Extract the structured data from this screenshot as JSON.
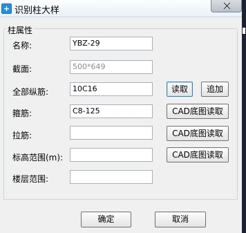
{
  "window": {
    "title": "识别柱大样",
    "close_glyph": "✕"
  },
  "group": {
    "title": "柱属性"
  },
  "fields": {
    "name": {
      "label": "名称:",
      "value": "YBZ-29"
    },
    "section": {
      "label": "截面:",
      "value": "500*649"
    },
    "all_longitudinal": {
      "label": "全部纵筋:",
      "value": "10C16"
    },
    "stirrup": {
      "label": "箍筋:",
      "value": "C8-125"
    },
    "tie": {
      "label": "拉筋:",
      "value": ""
    },
    "elevation_range": {
      "label": "标高范围(m):",
      "value": ""
    },
    "floor_range": {
      "label": "楼层范围:",
      "value": ""
    }
  },
  "buttons": {
    "read": "读取",
    "append": "追加",
    "cad_read_stirrup": "CAD底图读取",
    "cad_read_tie": "CAD底图读取",
    "cad_read_elevation": "CAD底图读取",
    "ok": "确定",
    "cancel": "取消"
  }
}
